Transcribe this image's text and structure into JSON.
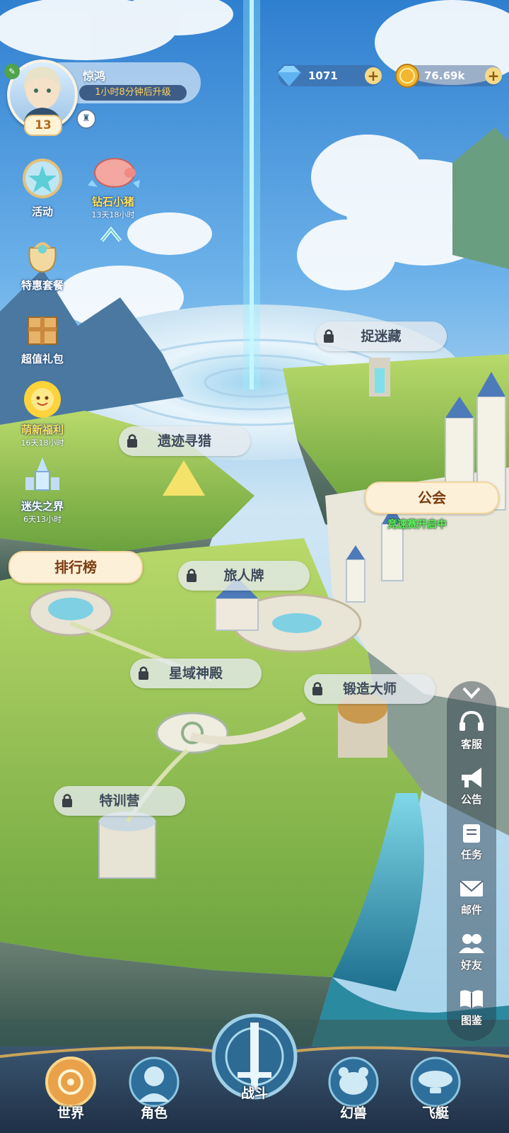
{
  "player": {
    "name": "惊鸿",
    "level": "13",
    "upgrade_timer": "1小时8分钟后升级"
  },
  "currency": {
    "diamonds": "1071",
    "gold": "76.69k"
  },
  "left_menu": [
    {
      "label": "活动",
      "sub": ""
    },
    {
      "label": "钻石小猪",
      "sub": "13天18小时"
    },
    {
      "label": "特惠套餐",
      "sub": ""
    },
    {
      "label": "超值礼包",
      "sub": ""
    },
    {
      "label": "萌新福利",
      "sub": "16天18小时"
    },
    {
      "label": "迷失之界",
      "sub": "6天13小时"
    }
  ],
  "locations": {
    "hide_seek": "捉迷藏",
    "relic_hunt": "遗迹寻猎",
    "guild": "公会",
    "guild_status": "竞速赛开启中",
    "ranking": "排行榜",
    "traveler_card": "旅人牌",
    "star_temple": "星域神殿",
    "forge_master": "锻造大师",
    "training_camp": "特训营"
  },
  "right_menu": [
    {
      "label": "客服"
    },
    {
      "label": "公告"
    },
    {
      "label": "任务"
    },
    {
      "label": "邮件"
    },
    {
      "label": "好友"
    },
    {
      "label": "图鉴"
    }
  ],
  "bottom_nav": [
    {
      "label": "世界"
    },
    {
      "label": "角色"
    },
    {
      "label": "战斗"
    },
    {
      "label": "幻兽"
    },
    {
      "label": "飞艇"
    }
  ]
}
